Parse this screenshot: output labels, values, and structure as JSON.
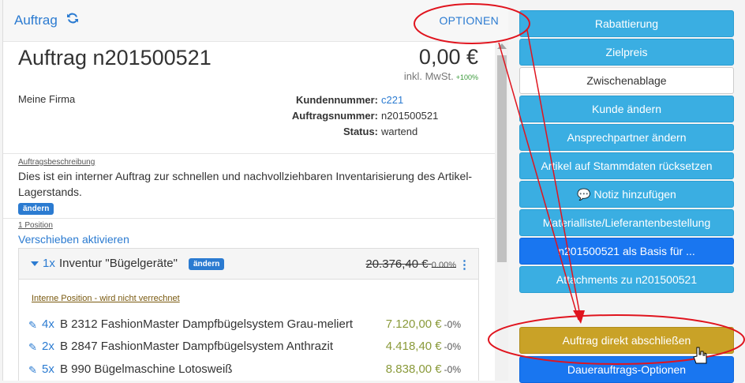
{
  "header": {
    "title": "Auftrag",
    "refresh_icon": "refresh-icon",
    "options_label": "OPTIONEN"
  },
  "order": {
    "heading": "Auftrag n201500521",
    "price": "0,00 €",
    "tax_note": "inkl. MwSt.",
    "tax_pct": "+100%",
    "company": "Meine Firma",
    "fields": {
      "kundennummer_label": "Kundennummer:",
      "kundennummer_value": "c221",
      "auftragsnummer_label": "Auftragsnummer:",
      "auftragsnummer_value": "n201500521",
      "status_label": "Status:",
      "status_value": "wartend"
    }
  },
  "description": {
    "label": "Auftragsbeschreibung",
    "text": "Dies ist ein interner Auftrag zur schnellen und nachvollziehbaren Inventarisierung des Artikel-Lagerstands.",
    "edit_label": "ändern"
  },
  "positions": {
    "count_label": "1 Position",
    "move_label": "Verschieben aktivieren",
    "group": {
      "qty": "1x",
      "name": "Inventur \"Bügelgeräte\"",
      "edit_label": "ändern",
      "price": "20.376,40 €",
      "pct": "0.00%",
      "internal_label": "Interne Position - wird nicht verrechnet",
      "rows": [
        {
          "qty": "4x",
          "name": "B 2312 FashionMaster Dampfbügelsystem Grau-meliert",
          "amount": "7.120,00 €",
          "pct": "-0%"
        },
        {
          "qty": "2x",
          "name": "B 2847 FashionMaster Dampfbügelsystem Anthrazit",
          "amount": "4.418,40 €",
          "pct": "-0%"
        },
        {
          "qty": "5x",
          "name": "B 990 Bügelmaschine Lotosweiß",
          "amount": "8.838,00 €",
          "pct": "-0%"
        }
      ]
    }
  },
  "actions": {
    "rabattierung": "Rabattierung",
    "zielpreis": "Zielpreis",
    "zwischenablage": "Zwischenablage",
    "kunde_aendern": "Kunde ändern",
    "ansprechpartner": "Ansprechpartner ändern",
    "artikel_reset": "Artikel auf Stammdaten rücksetzen",
    "notiz": "Notiz hinzufügen",
    "materialliste": "Materialliste/Lieferantenbestellung",
    "basis": "n201500521 als Basis für ...",
    "attachments": "Attachments zu n201500521",
    "abschliessen": "Auftrag direkt abschließen",
    "dauerauftrag": "Dauerauftrags-Optionen"
  },
  "colors": {
    "link": "#2b7bd1",
    "cyan_button": "#3aaee2",
    "blue_button": "#1976f0",
    "gold_button": "#c9a227",
    "annotation": "#e0141e"
  }
}
